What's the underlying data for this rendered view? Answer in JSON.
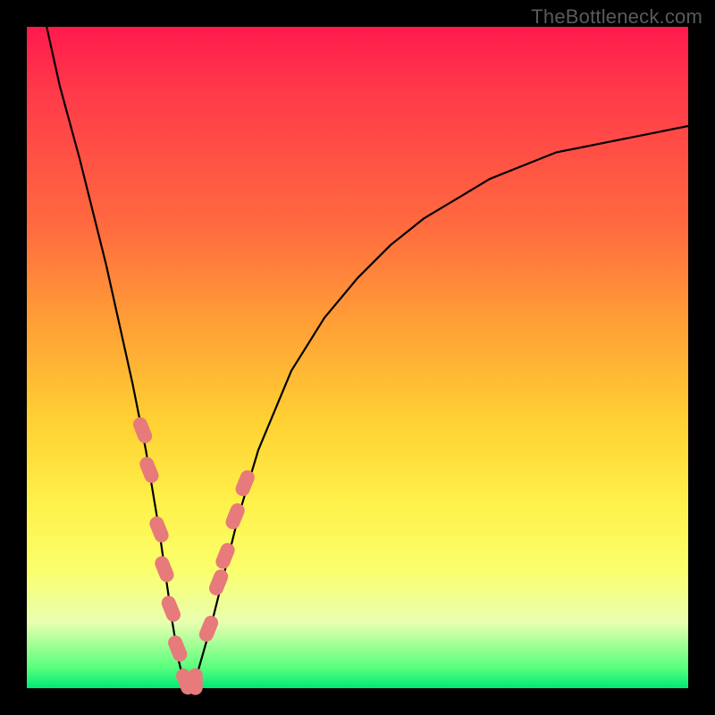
{
  "watermark": "TheBottleneck.com",
  "chart_data": {
    "type": "line",
    "title": "",
    "xlabel": "",
    "ylabel": "",
    "xlim": [
      0,
      100
    ],
    "ylim": [
      0,
      100
    ],
    "series": [
      {
        "name": "bottleneck-curve",
        "x": [
          3,
          5,
          8,
          10,
          12,
          14,
          16,
          18,
          19,
          20,
          21,
          22,
          23,
          24,
          25,
          26,
          28,
          30,
          32,
          35,
          40,
          45,
          50,
          55,
          60,
          65,
          70,
          75,
          80,
          85,
          90,
          95,
          100
        ],
        "y": [
          100,
          91,
          80,
          72,
          64,
          55,
          46,
          36,
          30,
          24,
          17,
          10,
          4,
          0,
          0,
          3,
          10,
          18,
          26,
          36,
          48,
          56,
          62,
          67,
          71,
          74,
          77,
          79,
          81,
          82,
          83,
          84,
          85
        ]
      }
    ],
    "markers": {
      "name": "highlighted-points",
      "color": "#e77a7a",
      "points": [
        {
          "x": 17.5,
          "y": 39
        },
        {
          "x": 18.5,
          "y": 33
        },
        {
          "x": 20.0,
          "y": 24
        },
        {
          "x": 20.8,
          "y": 18
        },
        {
          "x": 21.8,
          "y": 12
        },
        {
          "x": 22.8,
          "y": 6
        },
        {
          "x": 24.0,
          "y": 1
        },
        {
          "x": 25.5,
          "y": 1
        },
        {
          "x": 27.5,
          "y": 9
        },
        {
          "x": 29.0,
          "y": 16
        },
        {
          "x": 30.0,
          "y": 20
        },
        {
          "x": 31.5,
          "y": 26
        },
        {
          "x": 33.0,
          "y": 31
        }
      ]
    }
  }
}
